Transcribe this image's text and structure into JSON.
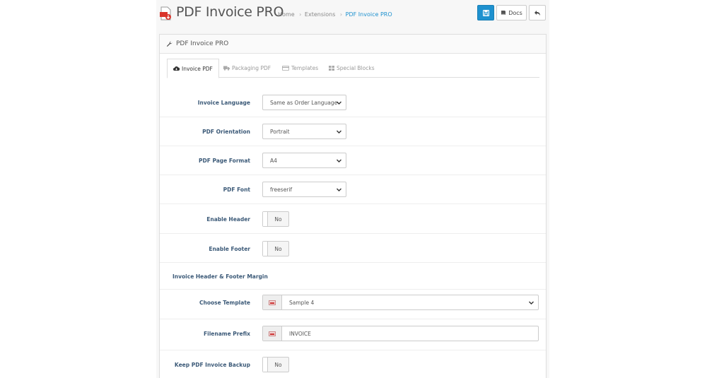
{
  "header": {
    "app_title": "PDF Invoice PRO",
    "breadcrumb": [
      "Home",
      "Extensions",
      "PDF Invoice PRO"
    ],
    "docs_label": "Docs",
    "accent": "#1e91cf"
  },
  "panel": {
    "title": "PDF Invoice PRO"
  },
  "tabs": [
    {
      "label": "Invoice PDF",
      "icon": "cloud-download-icon",
      "active": true
    },
    {
      "label": "Packaging PDF",
      "icon": "truck-icon",
      "active": false
    },
    {
      "label": "Templates",
      "icon": "credit-card-icon",
      "active": false
    },
    {
      "label": "Special Blocks",
      "icon": "grid-icon",
      "active": false
    }
  ],
  "form": {
    "invoice_language": {
      "label": "Invoice Language",
      "value": "Same as Order Language"
    },
    "pdf_orientation": {
      "label": "PDF Orientation",
      "value": "Portrait"
    },
    "pdf_page_format": {
      "label": "PDF Page Format",
      "value": "A4"
    },
    "pdf_font": {
      "label": "PDF Font",
      "value": "freeserif"
    },
    "enable_header": {
      "label": "Enable Header",
      "value": "No"
    },
    "enable_footer": {
      "label": "Enable Footer",
      "value": "No"
    },
    "margin_section": {
      "label": "Invoice Header & Footer Margin"
    },
    "choose_template": {
      "label": "Choose Template",
      "value": "Sample 4"
    },
    "filename_prefix": {
      "label": "Filename Prefix",
      "value": "INVOICE"
    },
    "keep_backup": {
      "label": "Keep PDF Invoice Backup",
      "value": "No"
    }
  }
}
